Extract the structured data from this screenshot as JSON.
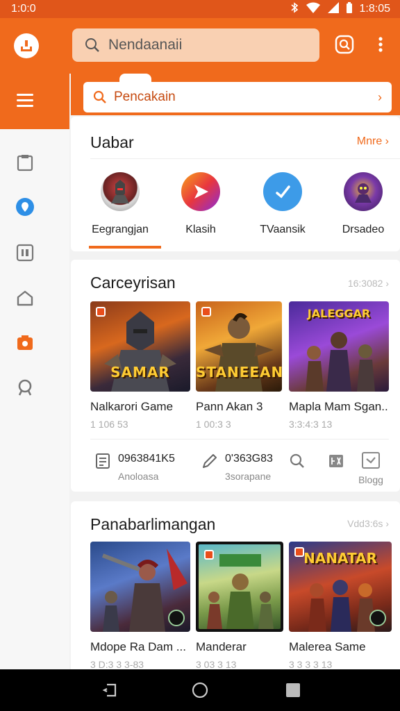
{
  "status": {
    "time_left": "1:0:0",
    "time_right": "1:8:05"
  },
  "search_top": {
    "placeholder": "Nendaanaii"
  },
  "search_main": {
    "placeholder": "Pencakain"
  },
  "section_categories": {
    "title": "Uabar",
    "more": "Mnre",
    "items": [
      {
        "label": "Eegrangjan",
        "icon": "game-avatar-icon"
      },
      {
        "label": "Klasih",
        "icon": "arrow-play-icon"
      },
      {
        "label": "TVaansik",
        "icon": "checkmark-icon"
      },
      {
        "label": "Drsadeo",
        "icon": "game-avatar-icon"
      }
    ]
  },
  "section_games": {
    "title": "Carceyrisan",
    "more": "16:3082",
    "games": [
      {
        "name": "Nalkarori Game",
        "meta": "1 106 53",
        "art": "SAMAR"
      },
      {
        "name": "Pann Akan 3",
        "meta": "1 00:3 3",
        "art": "STANEEAN"
      },
      {
        "name": "Mapla Mam Sgan...",
        "meta": "3:3:4:3 13",
        "art": "JALEGGAR"
      }
    ],
    "stats": [
      {
        "value": "0963841K5",
        "label": "Anoloasa",
        "icon": "document-icon"
      },
      {
        "value": "0'363G83",
        "label": "3sorapane",
        "icon": "pen-icon"
      }
    ],
    "actions": [
      {
        "icon": "search-icon"
      },
      {
        "icon": "image-icon"
      },
      {
        "icon": "check-box-icon",
        "label": "Blogg"
      }
    ]
  },
  "section_popular": {
    "title": "Panabarlimangan",
    "more": "Vdd3:6s",
    "games": [
      {
        "name": "Mdope Ra Dam ...",
        "meta": "3 D:3 3 3-83"
      },
      {
        "name": "Manderar",
        "meta": "3 03 3 13"
      },
      {
        "name": "Malerea Same",
        "meta": "3 3 3 3 13",
        "art": "NANATAR"
      }
    ]
  },
  "colors": {
    "accent": "#f06a1c",
    "statusbar": "#e0561a"
  }
}
